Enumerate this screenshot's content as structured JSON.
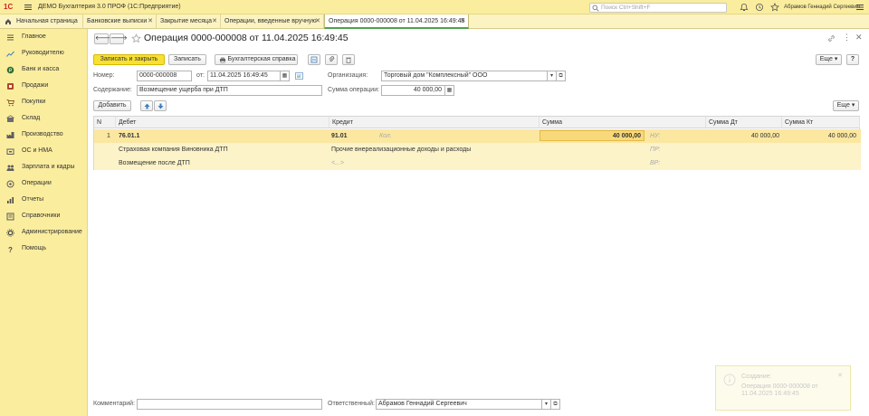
{
  "titlebar": {
    "logo": "1С",
    "app_title": "ДЕМО Бухгалтерия 3.0 ПРОФ  (1С:Предприятие)",
    "search_placeholder": "Поиск Ctrl+Shift+F",
    "user": "Абрамов Геннадий Сергеевич"
  },
  "tabs": [
    {
      "label": "Начальная страница",
      "active": false
    },
    {
      "label": "Банковские выписки",
      "active": false
    },
    {
      "label": "Закрытие месяца",
      "active": false
    },
    {
      "label": "Операции, введенные вручную",
      "active": false
    },
    {
      "label": "Операция 0000-000008 от 11.04.2025 16:49:45",
      "active": true
    }
  ],
  "sidebar": [
    {
      "label": "Главное",
      "icon": "menu-icon",
      "color": "#5a5a5a"
    },
    {
      "label": "Руководителю",
      "icon": "chart-icon",
      "color": "#3d7dc0"
    },
    {
      "label": "Банк и касса",
      "icon": "bank-icon",
      "color": "#2f6f2f"
    },
    {
      "label": "Продажи",
      "icon": "sales-icon",
      "color": "#b2452b"
    },
    {
      "label": "Покупки",
      "icon": "cart-icon",
      "color": "#8a5a2a"
    },
    {
      "label": "Склад",
      "icon": "warehouse-icon",
      "color": "#6d6d6d"
    },
    {
      "label": "Производство",
      "icon": "factory-icon",
      "color": "#5e5e5e"
    },
    {
      "label": "ОС и НМА",
      "icon": "assets-icon",
      "color": "#5e5e5e"
    },
    {
      "label": "Зарплата и кадры",
      "icon": "people-icon",
      "color": "#5e5e5e"
    },
    {
      "label": "Операции",
      "icon": "operations-icon",
      "color": "#5e5e5e"
    },
    {
      "label": "Отчеты",
      "icon": "reports-icon",
      "color": "#4a4a4a"
    },
    {
      "label": "Справочники",
      "icon": "book-icon",
      "color": "#4a4a4a"
    },
    {
      "label": "Администрирование",
      "icon": "gear-icon",
      "color": "#4a4a4a"
    },
    {
      "label": "Помощь",
      "icon": "help-icon",
      "color": "#4a4a4a"
    }
  ],
  "form": {
    "title": "Операция 0000-000008 от 11.04.2025 16:49:45",
    "buttons": {
      "save_close": "Записать и закрыть",
      "save": "Записать",
      "report": "Бухгалтерская справка",
      "more": "Еще",
      "help": "?",
      "add": "Добавить",
      "more_table": "Еще"
    },
    "fields": {
      "number_label": "Номер:",
      "number_value": "0000-000008",
      "date_label": "от:",
      "date_value": "11.04.2025 16:49:45",
      "org_label": "Организация:",
      "org_value": "Торговый дом \"Комплексный\" ООО",
      "content_label": "Содержание:",
      "content_value": "Возмещение ущерба при ДТП",
      "sum_label": "Сумма операции:",
      "sum_value": "40 000,00",
      "comment_label": "Комментарий:",
      "comment_value": "",
      "responsible_label": "Ответственный:",
      "responsible_value": "Абрамов Геннадий Сергеевич"
    }
  },
  "table": {
    "headers": [
      "N",
      "Дебет",
      "Кредит",
      "Сумма",
      "Сумма Дт",
      "Сумма Кт"
    ],
    "rows": [
      {
        "n": "1",
        "debit": "76.01.1",
        "credit": "91.01",
        "credit_hint": "Кол.",
        "sum": "40 000,00",
        "tax": "НУ:",
        "sum_dt": "40 000,00",
        "sum_kt": "40 000,00"
      },
      {
        "debit": "Страховая компания Виновника ДТП",
        "credit": "Прочие внереализационные доходы и расходы",
        "tax": "ПР:"
      },
      {
        "debit": "Возмещение после ДТП",
        "credit": "<...>",
        "tax": "ВР:"
      }
    ]
  },
  "notification": {
    "title": "Создание:",
    "text": "Операция 0000-000008 от 11.04.2025 16:49:45"
  }
}
